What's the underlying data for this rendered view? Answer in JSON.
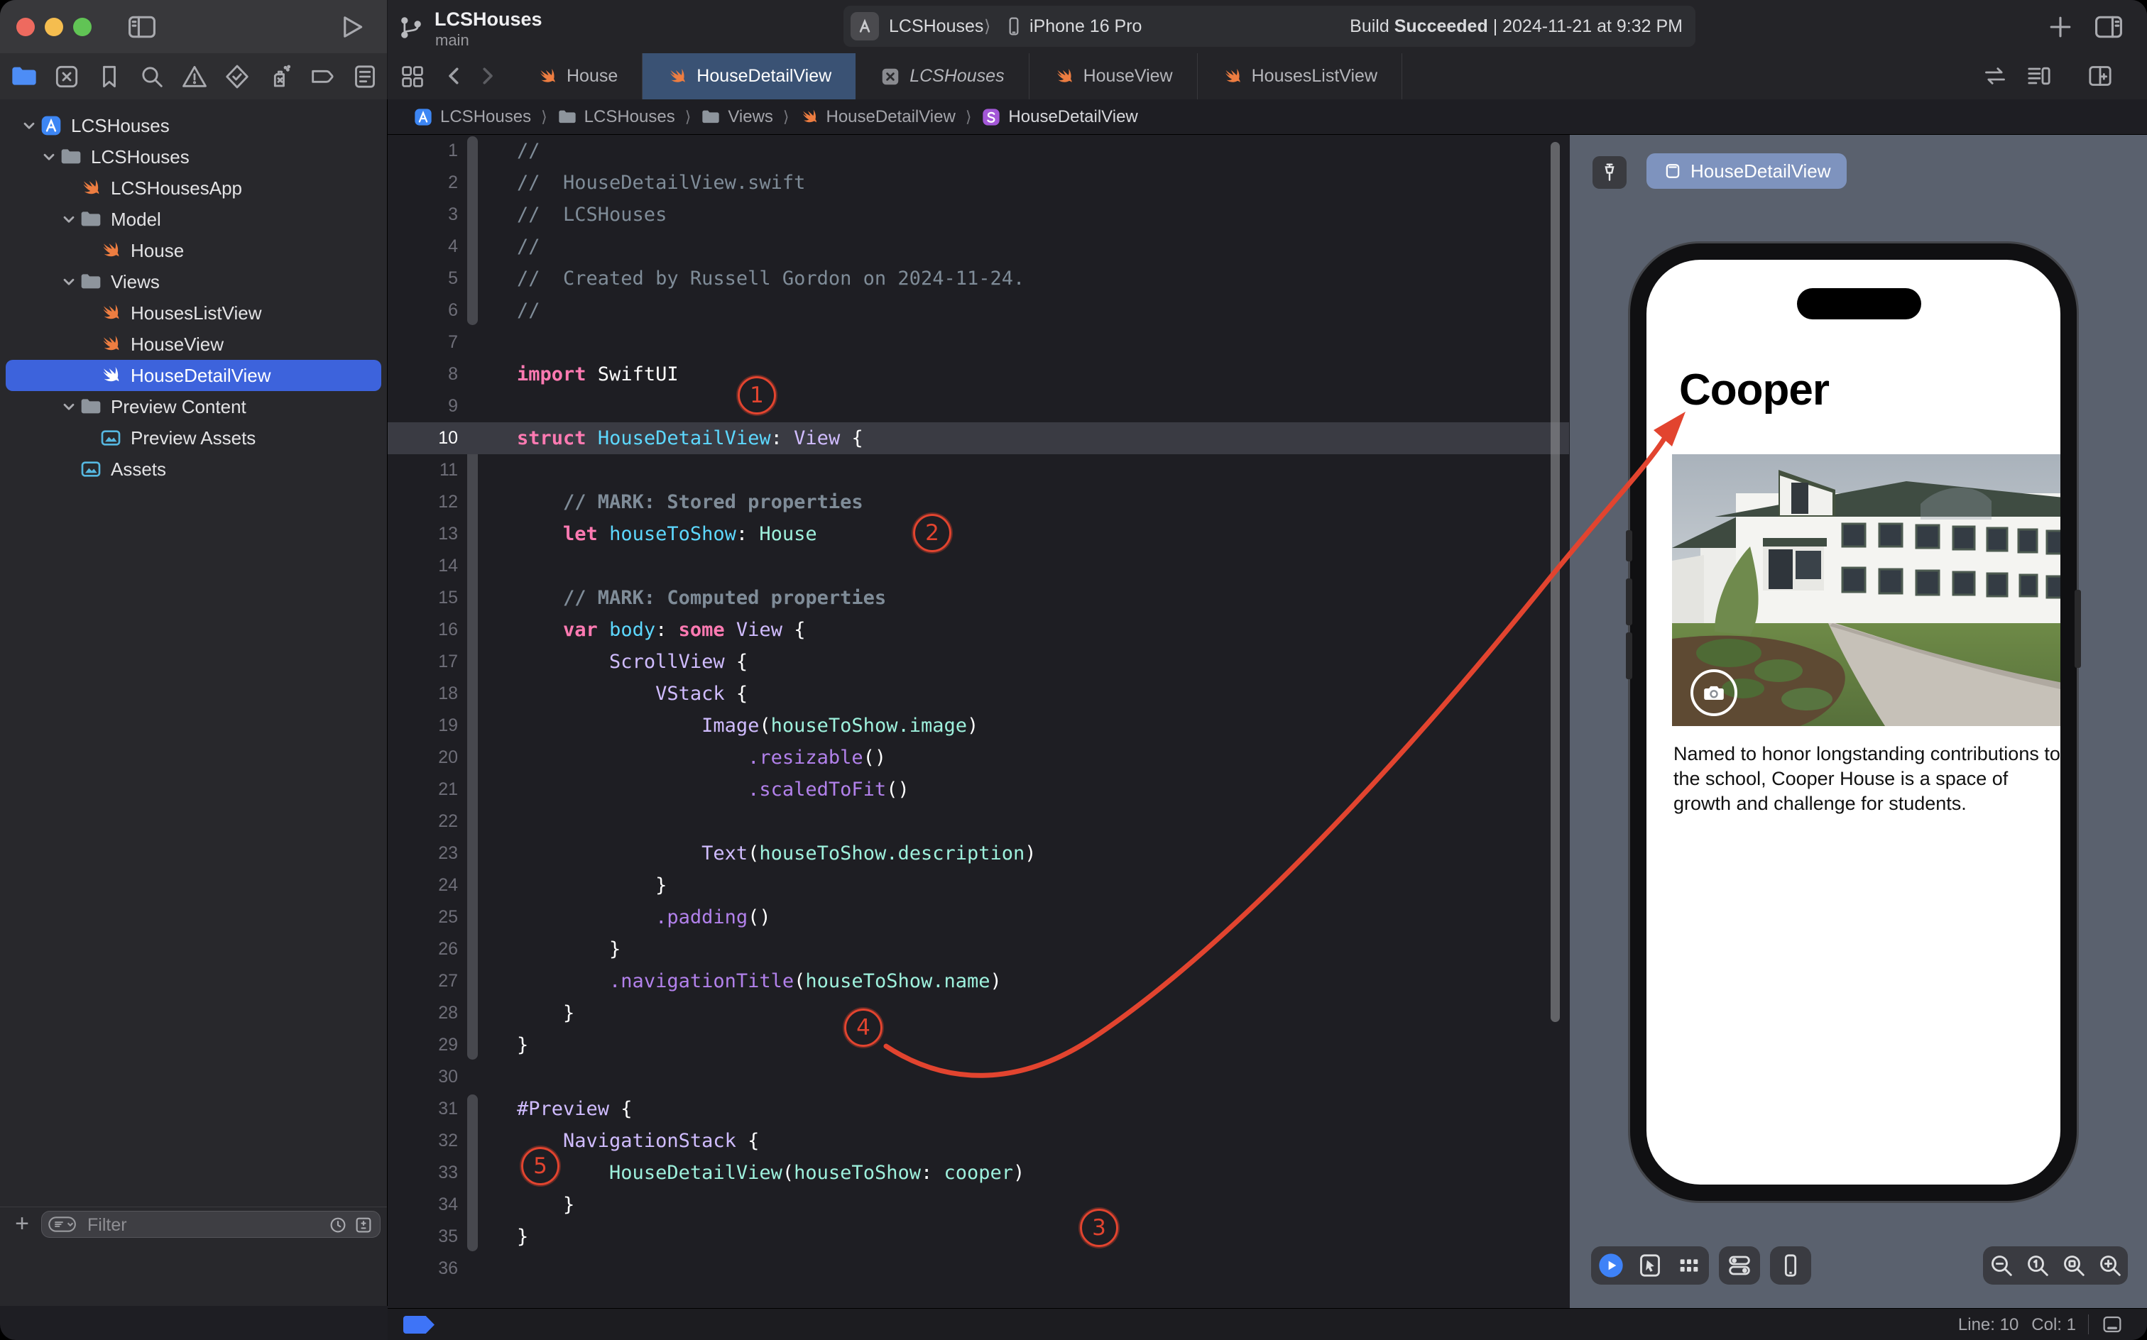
{
  "colors": {
    "accent_blue": "#3D63DC",
    "tab_selected": "#3A5274",
    "preview_background": "#5A616E",
    "annotation_red": "#E2442F",
    "swift_orange": "#ED7D41",
    "build_chip_blue": "#7E93BE"
  },
  "titlebar": {
    "project": "LCSHouses",
    "branch": "main",
    "scheme": "LCSHouses",
    "scheme_separator": "⟩",
    "run_destination": "iPhone 16 Pro",
    "status_build": "Build",
    "status_result": "Succeeded",
    "status_rest": "| 2024-11-21 at 9:32 PM",
    "icons": [
      "sidebar-toggle-icon",
      "play-icon",
      "branch-icon",
      "add-tab-icon",
      "inspector-toggle-icon"
    ]
  },
  "navigator": {
    "icons": [
      "project-navigator-icon",
      "source-control-icon",
      "bookmarks-icon",
      "find-icon",
      "issues-icon",
      "tests-icon",
      "debug-icon",
      "breakpoints-icon",
      "reports-icon"
    ],
    "active_index": 0
  },
  "tabs": [
    {
      "label": "House",
      "icon": "swift"
    },
    {
      "label": "HouseDetailView",
      "icon": "swift",
      "selected": true
    },
    {
      "label": "LCSHouses",
      "icon": "xsquare",
      "italic": true
    },
    {
      "label": "HouseView",
      "icon": "swift"
    },
    {
      "label": "HousesListView",
      "icon": "swift"
    }
  ],
  "tabrow_right_icons": [
    "swap-icon",
    "minimap-icon",
    "split-editor-icon"
  ],
  "jumpbar": [
    {
      "label": "LCSHouses",
      "icon": "app"
    },
    {
      "label": "LCSHouses",
      "icon": "folder"
    },
    {
      "label": "Views",
      "icon": "folder"
    },
    {
      "label": "HouseDetailView",
      "icon": "swift"
    },
    {
      "label": "HouseDetailView",
      "icon": "ssym"
    }
  ],
  "jumpbar_separator": "⟩",
  "sidebar": {
    "items": [
      {
        "label": "LCSHouses",
        "icon": "app",
        "depth": 0,
        "chevron": true
      },
      {
        "label": "LCSHouses",
        "icon": "folder",
        "depth": 1,
        "chevron": true
      },
      {
        "label": "LCSHousesApp",
        "icon": "swift",
        "depth": 2
      },
      {
        "label": "Model",
        "icon": "folder",
        "depth": 2,
        "chevron": true
      },
      {
        "label": "House",
        "icon": "swift",
        "depth": 3
      },
      {
        "label": "Views",
        "icon": "folder",
        "depth": 2,
        "chevron": true
      },
      {
        "label": "HousesListView",
        "icon": "swift",
        "depth": 3
      },
      {
        "label": "HouseView",
        "icon": "swift",
        "depth": 3
      },
      {
        "label": "HouseDetailView",
        "icon": "swift",
        "depth": 3,
        "selected": true
      },
      {
        "label": "Preview Content",
        "icon": "folder",
        "depth": 2,
        "chevron": true
      },
      {
        "label": "Preview Assets",
        "icon": "photos",
        "depth": 3
      },
      {
        "label": "Assets",
        "icon": "photos",
        "depth": 2
      }
    ],
    "filter": {
      "add_label": "+",
      "placeholder": "Filter"
    }
  },
  "editor": {
    "lines": [
      {
        "n": 1,
        "segs": [
          [
            "c",
            "//"
          ]
        ]
      },
      {
        "n": 2,
        "segs": [
          [
            "c",
            "//  HouseDetailView.swift"
          ]
        ]
      },
      {
        "n": 3,
        "segs": [
          [
            "c",
            "//  LCSHouses"
          ]
        ]
      },
      {
        "n": 4,
        "segs": [
          [
            "c",
            "//"
          ]
        ]
      },
      {
        "n": 5,
        "segs": [
          [
            "c",
            "//  Created by Russell Gordon on 2024-11-24."
          ]
        ]
      },
      {
        "n": 6,
        "segs": [
          [
            "c",
            "//"
          ]
        ]
      },
      {
        "n": 7,
        "segs": []
      },
      {
        "n": 8,
        "segs": [
          [
            "k",
            "import"
          ],
          [
            "p",
            " SwiftUI"
          ]
        ]
      },
      {
        "n": 9,
        "segs": []
      },
      {
        "n": 10,
        "hl": true,
        "segs": [
          [
            "k",
            "struct"
          ],
          [
            "p",
            " "
          ],
          [
            "d",
            "HouseDetailView"
          ],
          [
            "p",
            ": "
          ],
          [
            "t",
            "View"
          ],
          [
            "p",
            " {"
          ]
        ]
      },
      {
        "n": 11,
        "segs": []
      },
      {
        "n": 12,
        "segs": [
          [
            "cb",
            "    // MARK: Stored properties"
          ]
        ]
      },
      {
        "n": 13,
        "segs": [
          [
            "p",
            "    "
          ],
          [
            "k",
            "let"
          ],
          [
            "p",
            " "
          ],
          [
            "d",
            "houseToShow"
          ],
          [
            "p",
            ": "
          ],
          [
            "g",
            "House"
          ]
        ]
      },
      {
        "n": 14,
        "segs": []
      },
      {
        "n": 15,
        "segs": [
          [
            "cb",
            "    // MARK: Computed properties"
          ]
        ]
      },
      {
        "n": 16,
        "segs": [
          [
            "p",
            "    "
          ],
          [
            "k",
            "var"
          ],
          [
            "p",
            " "
          ],
          [
            "d",
            "body"
          ],
          [
            "p",
            ": "
          ],
          [
            "k",
            "some"
          ],
          [
            "p",
            " "
          ],
          [
            "t",
            "View"
          ],
          [
            "p",
            " {"
          ]
        ]
      },
      {
        "n": 17,
        "segs": [
          [
            "p",
            "        "
          ],
          [
            "t",
            "ScrollView"
          ],
          [
            "p",
            " {"
          ]
        ]
      },
      {
        "n": 18,
        "segs": [
          [
            "p",
            "            "
          ],
          [
            "t",
            "VStack"
          ],
          [
            "p",
            " {"
          ]
        ]
      },
      {
        "n": 19,
        "segs": [
          [
            "p",
            "                "
          ],
          [
            "t",
            "Image"
          ],
          [
            "p",
            "("
          ],
          [
            "g",
            "houseToShow.image"
          ],
          [
            "p",
            ")"
          ]
        ]
      },
      {
        "n": 20,
        "segs": [
          [
            "p",
            "                    "
          ],
          [
            "m",
            ".resizable"
          ],
          [
            "p",
            "()"
          ]
        ]
      },
      {
        "n": 21,
        "segs": [
          [
            "p",
            "                    "
          ],
          [
            "m",
            ".scaledToFit"
          ],
          [
            "p",
            "()"
          ]
        ]
      },
      {
        "n": 22,
        "segs": []
      },
      {
        "n": 23,
        "segs": [
          [
            "p",
            "                "
          ],
          [
            "t",
            "Text"
          ],
          [
            "p",
            "("
          ],
          [
            "g",
            "houseToShow.description"
          ],
          [
            "p",
            ")"
          ]
        ]
      },
      {
        "n": 24,
        "segs": [
          [
            "p",
            "            }"
          ]
        ]
      },
      {
        "n": 25,
        "segs": [
          [
            "p",
            "            "
          ],
          [
            "m",
            ".padding"
          ],
          [
            "p",
            "()"
          ]
        ]
      },
      {
        "n": 26,
        "segs": [
          [
            "p",
            "        }"
          ]
        ]
      },
      {
        "n": 27,
        "segs": [
          [
            "p",
            "        "
          ],
          [
            "m",
            ".navigationTitle"
          ],
          [
            "p",
            "("
          ],
          [
            "g",
            "houseToShow.name"
          ],
          [
            "p",
            ")"
          ]
        ]
      },
      {
        "n": 28,
        "segs": [
          [
            "p",
            "    }"
          ]
        ]
      },
      {
        "n": 29,
        "segs": [
          [
            "p",
            "}"
          ]
        ]
      },
      {
        "n": 30,
        "segs": []
      },
      {
        "n": 31,
        "segs": [
          [
            "t",
            "#Preview"
          ],
          [
            "p",
            " {"
          ]
        ]
      },
      {
        "n": 32,
        "segs": [
          [
            "p",
            "    "
          ],
          [
            "t",
            "NavigationStack"
          ],
          [
            "p",
            " {"
          ]
        ]
      },
      {
        "n": 33,
        "segs": [
          [
            "p",
            "        "
          ],
          [
            "g",
            "HouseDetailView"
          ],
          [
            "p",
            "("
          ],
          [
            "g",
            "houseToShow"
          ],
          [
            "p",
            ": "
          ],
          [
            "g",
            "cooper"
          ],
          [
            "p",
            ")"
          ]
        ]
      },
      {
        "n": 34,
        "segs": [
          [
            "p",
            "    }"
          ]
        ]
      },
      {
        "n": 35,
        "segs": [
          [
            "p",
            "}"
          ]
        ]
      },
      {
        "n": 36,
        "segs": []
      }
    ]
  },
  "annotations": {
    "labels": [
      "1",
      "2",
      "3",
      "4",
      "5"
    ]
  },
  "preview": {
    "pin_icon": "pin-icon",
    "chip_label": "HouseDetailView",
    "nav_title": "Cooper",
    "description": "Named to honor longstanding contributions to the school, Cooper House is a space of growth and challenge for students.",
    "camera_icon": "camera-icon",
    "toolbar_icons": [
      "live-preview-play-icon",
      "selectable-mode-icon",
      "variants-icon"
    ],
    "device_settings_icon": "device-settings-icon",
    "device_icon": "device-icon",
    "zoom_icons": [
      "zoom-out-icon",
      "zoom-actual-size-icon",
      "zoom-to-fit-icon",
      "zoom-in-icon"
    ]
  },
  "statusbar": {
    "line": "Line: 10",
    "col": "Col: 1"
  }
}
